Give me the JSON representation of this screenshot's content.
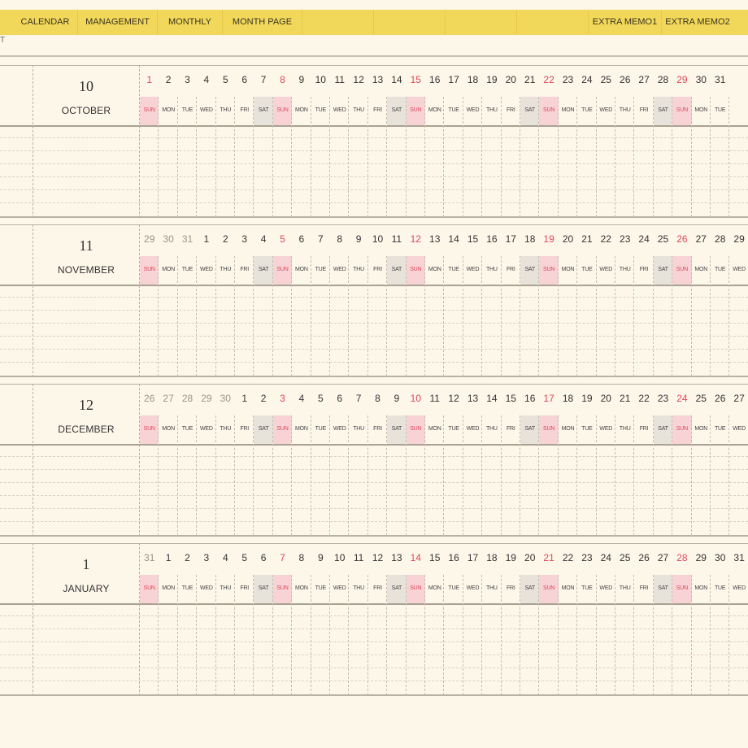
{
  "toolbar": {
    "tabs": [
      {
        "label": "CALENDAR"
      },
      {
        "label": "MANAGEMENT"
      },
      {
        "label": "MONTHLY"
      },
      {
        "label": "MONTH PAGE"
      },
      {
        "label": ""
      },
      {
        "label": ""
      },
      {
        "label": ""
      },
      {
        "label": ""
      },
      {
        "label": "EXTRA MEMO1"
      },
      {
        "label": "EXTRA MEMO2"
      }
    ]
  },
  "header": {
    "side_mark": "T"
  },
  "weekday_labels": [
    "SUN",
    "MON",
    "TUE",
    "WED",
    "THU",
    "FRI",
    "SAT"
  ],
  "months": [
    {
      "number": "10",
      "name": "OCTOBER",
      "days": [
        "1",
        "2",
        "3",
        "4",
        "5",
        "6",
        "7",
        "8",
        "9",
        "10",
        "11",
        "12",
        "13",
        "14",
        "15",
        "16",
        "17",
        "18",
        "19",
        "20",
        "21",
        "22",
        "23",
        "24",
        "25",
        "26",
        "27",
        "28",
        "29",
        "30",
        "31"
      ],
      "leading_gray": 0
    },
    {
      "number": "11",
      "name": "NOVEMBER",
      "days": [
        "29",
        "30",
        "31",
        "1",
        "2",
        "3",
        "4",
        "5",
        "6",
        "7",
        "8",
        "9",
        "10",
        "11",
        "12",
        "13",
        "14",
        "15",
        "16",
        "17",
        "18",
        "19",
        "20",
        "21",
        "22",
        "23",
        "24",
        "25",
        "26",
        "27",
        "28",
        "29"
      ],
      "leading_gray": 3
    },
    {
      "number": "12",
      "name": "DECEMBER",
      "days": [
        "26",
        "27",
        "28",
        "29",
        "30",
        "1",
        "2",
        "3",
        "4",
        "5",
        "6",
        "7",
        "8",
        "9",
        "10",
        "11",
        "12",
        "13",
        "14",
        "15",
        "16",
        "17",
        "18",
        "19",
        "20",
        "21",
        "22",
        "23",
        "24",
        "25",
        "26",
        "27"
      ],
      "leading_gray": 5
    },
    {
      "number": "1",
      "name": "JANUARY",
      "days": [
        "31",
        "1",
        "2",
        "3",
        "4",
        "5",
        "6",
        "7",
        "8",
        "9",
        "10",
        "11",
        "12",
        "13",
        "14",
        "15",
        "16",
        "17",
        "18",
        "19",
        "20",
        "21",
        "22",
        "23",
        "24",
        "25",
        "26",
        "27",
        "28",
        "29",
        "30",
        "31"
      ],
      "leading_gray": 1
    }
  ],
  "colors": {
    "toolbar_bg": "#f2d85a",
    "page_bg": "#fdf7ea",
    "sunday": "#e0455b",
    "sunday_bg": "#f7d3d5",
    "saturday_bg": "#e8e3da"
  }
}
